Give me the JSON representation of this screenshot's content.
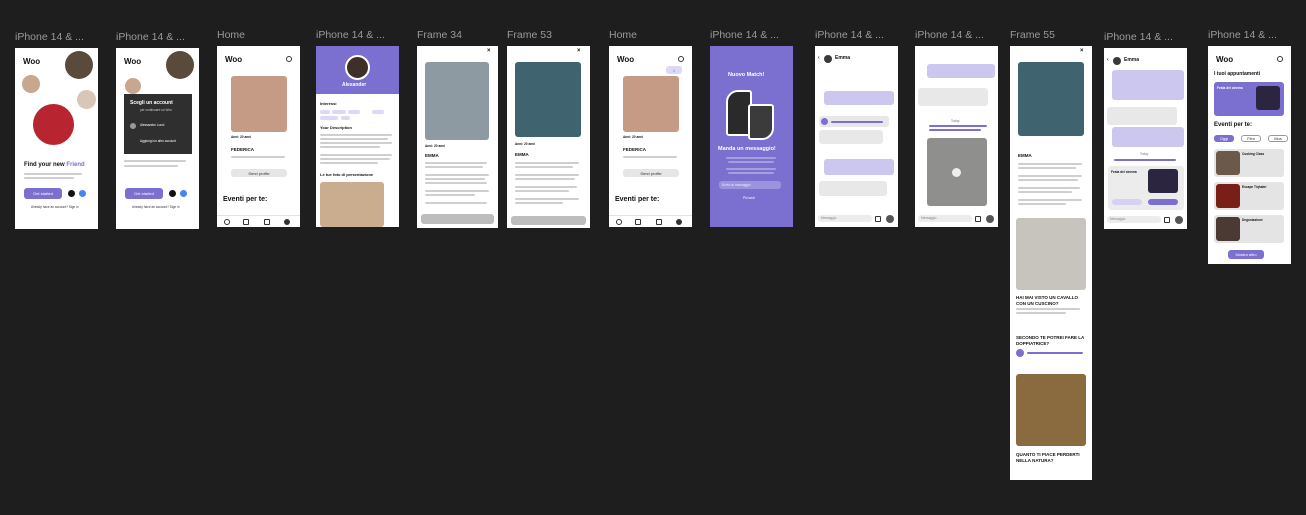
{
  "frames": {
    "f1": {
      "label": "iPhone 14 & ...",
      "logo": "Woo",
      "headline": "Find your new",
      "headline_accent": "Friend",
      "cta": "Get started",
      "signin": "Already have an account? Sign in"
    },
    "f2": {
      "label": "iPhone 14 & ...",
      "logo": "Woo",
      "dialog_title": "Scegli un account",
      "dialog_sub": "per continuare su Woo",
      "account_name": "Alessandro Lucci",
      "add_account": "Aggiungi un altro account",
      "cta": "Get started",
      "signin": "Already have an account? Sign in"
    },
    "f3": {
      "label": "Home",
      "logo": "Woo",
      "name": "FEDERICA",
      "age": "Anni: 20 anni",
      "action": "Send profile",
      "section": "Eventi per te:"
    },
    "f4": {
      "label": "iPhone 14 & ...",
      "name": "Alexander",
      "interests": "Interessi",
      "description": "Your Description",
      "gallery": "Le tue foto di presentazione"
    },
    "f5": {
      "label": "Frame 34",
      "name": "EMMA",
      "age": "Anni: 20 anni"
    },
    "f6": {
      "label": "Frame 53",
      "name": "EMMA",
      "age": "Anni: 20 anni"
    },
    "f7": {
      "label": "Home",
      "logo": "Woo",
      "name": "FEDERICA",
      "age": "Anni: 20 anni",
      "action": "Send profile",
      "section": "Eventi per te:",
      "badge": "1"
    },
    "f8": {
      "label": "iPhone 14 & ...",
      "title": "Nuovo Match!",
      "cta": "Manda un messaggio!",
      "input_placeholder": "Scrivi un messaggio",
      "later": "Più tardi"
    },
    "f9": {
      "label": "iPhone 14 & ...",
      "contact": "Emma",
      "input_placeholder": "Messaggio"
    },
    "f10": {
      "label": "iPhone 14 & ...",
      "contact": "Emma",
      "input_placeholder": "Messaggio",
      "today": "Today"
    },
    "f11": {
      "label": "Frame 55",
      "name": "EMMA",
      "post1_title": "HAI MAI VISTO UN CAVALLO CON UN CUSCINO?",
      "post2_title": "SECONDO TE POTREI FARE LA DOPPIATRICE?",
      "post3_title": "QUANTO TI PIACE PERDERTI NELLA NATURA?"
    },
    "f12": {
      "label": "iPhone 14 & ...",
      "contact": "Emma",
      "input_placeholder": "Messaggio",
      "event_title": "Festa del cinema",
      "today": "Today"
    },
    "f13": {
      "label": "iPhone 14 & ...",
      "logo": "Woo",
      "title": "I tuoi appuntamenti",
      "event1": "Festa del cinema",
      "section": "Eventi per te:",
      "tab1": "Oggi",
      "tab2": "Film",
      "tab3": "Mus",
      "ev_a": "Cooking Class",
      "ev_b": "Escape Tiqhater",
      "ev_c": "Degustazione",
      "more": "Mostra altro"
    }
  },
  "colors": {
    "accent": "#7b6fd0",
    "canvas": "#1e1e1e",
    "label": "#9a9a9a"
  }
}
